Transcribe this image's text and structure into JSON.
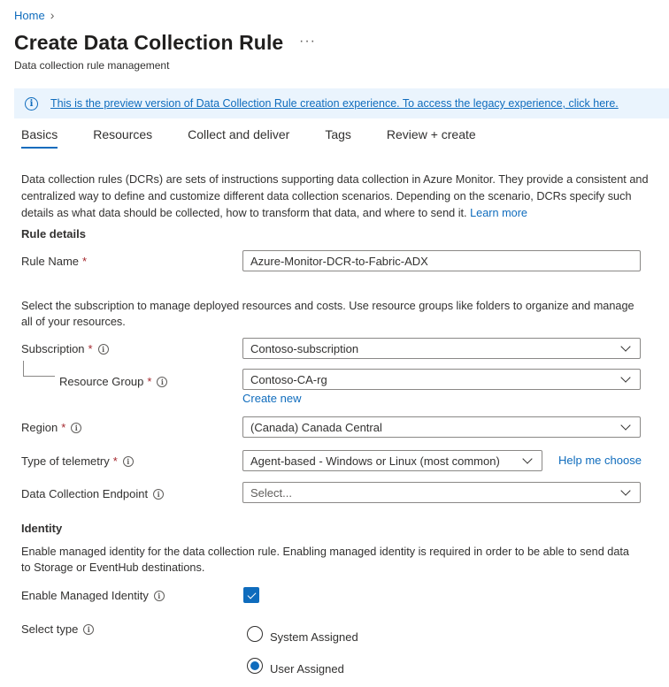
{
  "breadcrumb": {
    "home": "Home",
    "separator": "›"
  },
  "header": {
    "title": "Create Data Collection Rule",
    "more": "···",
    "subtitle": "Data collection rule management"
  },
  "banner": {
    "icon": "info-icon",
    "text": "This is the preview version of Data Collection Rule creation experience. To access the legacy experience, click here."
  },
  "tabs": [
    {
      "label": "Basics",
      "active": true
    },
    {
      "label": "Resources",
      "active": false
    },
    {
      "label": "Collect and deliver",
      "active": false
    },
    {
      "label": "Tags",
      "active": false
    },
    {
      "label": "Review + create",
      "active": false
    }
  ],
  "intro": {
    "text": "Data collection rules (DCRs) are sets of instructions supporting data collection in Azure Monitor. They provide a consistent and centralized way to define and customize different data collection scenarios. Depending on the scenario, DCRs specify such details as what data should be collected, how to transform that data, and where to send it.",
    "learn_more": "Learn more"
  },
  "rule_details": {
    "heading": "Rule details",
    "rule_name_label": "Rule Name",
    "rule_name_value": "Azure-Monitor-DCR-to-Fabric-ADX",
    "required_mark": "*"
  },
  "subscription_section": {
    "text": "Select the subscription to manage deployed resources and costs. Use resource groups like folders to organize and manage all of your resources.",
    "subscription_label": "Subscription",
    "subscription_value": "Contoso-subscription",
    "resource_group_label": "Resource Group",
    "resource_group_value": "Contoso-CA-rg",
    "create_new": "Create new",
    "region_label": "Region",
    "region_value": "(Canada) Canada Central",
    "telemetry_label": "Type of telemetry",
    "telemetry_value": "Agent-based - Windows or Linux (most common)",
    "help_me_choose": "Help me choose",
    "endpoint_label": "Data Collection Endpoint",
    "endpoint_placeholder": "Select..."
  },
  "identity": {
    "heading": "Identity",
    "text": "Enable managed identity for the data collection rule. Enabling managed identity is required in order to be able to send data to Storage or EventHub destinations.",
    "enable_label": "Enable Managed Identity",
    "enable_checked": true,
    "select_type_label": "Select type",
    "options": [
      {
        "label": "System Assigned",
        "checked": false
      },
      {
        "label": "User Assigned",
        "checked": true
      }
    ]
  },
  "colors": {
    "accent": "#0f6cbd",
    "required": "#a4262c",
    "banner_bg": "#eaf4fd"
  }
}
